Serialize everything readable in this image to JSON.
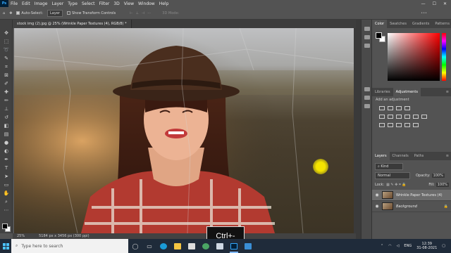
{
  "app": {
    "logo": "Ps"
  },
  "menubar": {
    "items": [
      "File",
      "Edit",
      "Image",
      "Layer",
      "Type",
      "Select",
      "Filter",
      "3D",
      "View",
      "Window",
      "Help"
    ],
    "window_controls": [
      "—",
      "☐",
      "✕"
    ]
  },
  "options_bar": {
    "auto_select_label": "Auto-Select:",
    "auto_select_target": "Layer",
    "show_transform_label": "Show Transform Controls",
    "mode_label": "3D Mode:",
    "more": "•••"
  },
  "document": {
    "tab_title": "stock img (2).jpg @ 25% (Wrinkle Paper Textures (4), RGB/8) *",
    "zoom": "25%",
    "dimensions": "5184 px x 3456 px (300 ppi)"
  },
  "panels": {
    "color_tabs": [
      "Color",
      "Swatches",
      "Gradients",
      "Patterns"
    ],
    "adjust_tabs": [
      "Libraries",
      "Adjustments"
    ],
    "adjust_label": "Add an adjustment",
    "layer_tabs": [
      "Layers",
      "Channels",
      "Paths"
    ],
    "kind_label": "Kind",
    "blend_mode": "Normal",
    "opacity_label": "Opacity:",
    "opacity_value": "100%",
    "lock_label": "Lock:",
    "fill_label": "Fill:",
    "fill_value": "100%",
    "layers": [
      {
        "name": "Wrinkle Paper Textures (4)",
        "selected": true
      },
      {
        "name": "Background",
        "selected": false,
        "italic": true
      }
    ]
  },
  "keyboard_hint": "Ctrl+-",
  "taskbar": {
    "search_placeholder": "Type here to search",
    "lang": "ENG",
    "time": "12:39",
    "date": "31-08-2021"
  }
}
